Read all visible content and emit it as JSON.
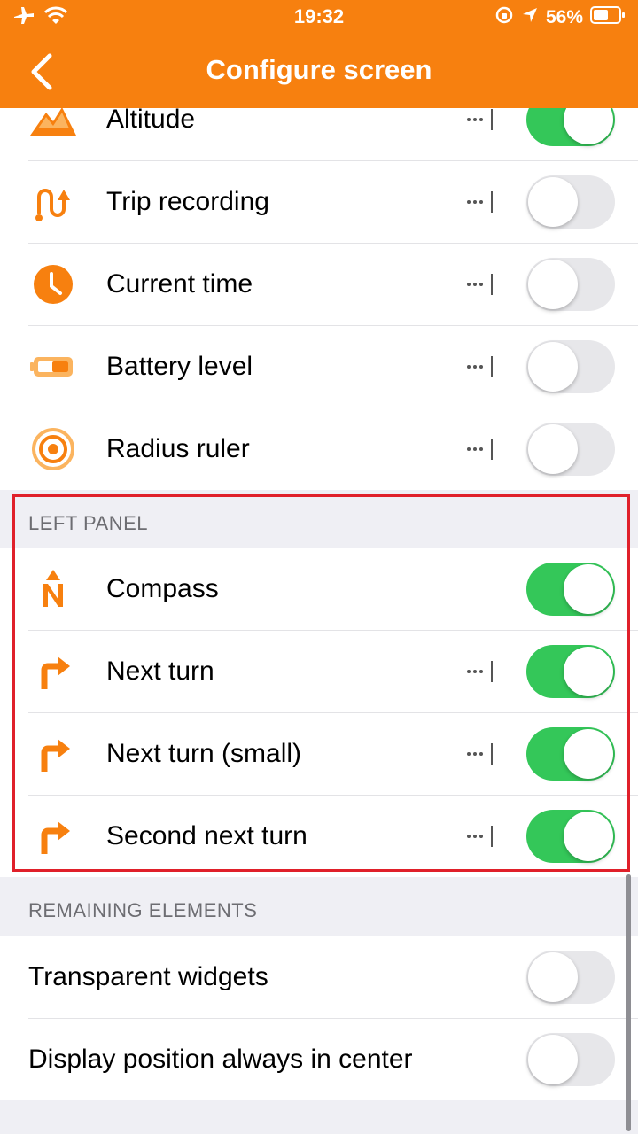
{
  "status_bar": {
    "time": "19:32",
    "battery": "56%"
  },
  "nav": {
    "title": "Configure screen",
    "back_icon": "chevron-left-icon"
  },
  "colors": {
    "accent": "#f7800f",
    "toggle_on": "#34c759",
    "toggle_off": "#e7e7ea",
    "highlight": "#e0202a"
  },
  "top_items": [
    {
      "label": "Altitude",
      "icon": "altitude-icon",
      "has_more": true,
      "enabled": true
    },
    {
      "label": "Trip recording",
      "icon": "trip-recording-icon",
      "has_more": true,
      "enabled": false
    },
    {
      "label": "Current time",
      "icon": "clock-icon",
      "has_more": true,
      "enabled": false
    },
    {
      "label": "Battery level",
      "icon": "battery-icon",
      "has_more": true,
      "enabled": false
    },
    {
      "label": "Radius ruler",
      "icon": "radius-ruler-icon",
      "has_more": true,
      "enabled": false
    }
  ],
  "left_panel": {
    "header": "LEFT PANEL",
    "items": [
      {
        "label": "Compass",
        "icon": "compass-icon",
        "has_more": false,
        "enabled": true
      },
      {
        "label": "Next turn",
        "icon": "turn-right-icon",
        "has_more": true,
        "enabled": true
      },
      {
        "label": "Next turn (small)",
        "icon": "turn-right-icon",
        "has_more": true,
        "enabled": true
      },
      {
        "label": "Second next turn",
        "icon": "turn-right-icon",
        "has_more": true,
        "enabled": true
      }
    ]
  },
  "remaining": {
    "header": "REMAINING ELEMENTS",
    "items": [
      {
        "label": "Transparent widgets",
        "enabled": false
      },
      {
        "label": "Display position always in center",
        "enabled": false
      }
    ]
  }
}
